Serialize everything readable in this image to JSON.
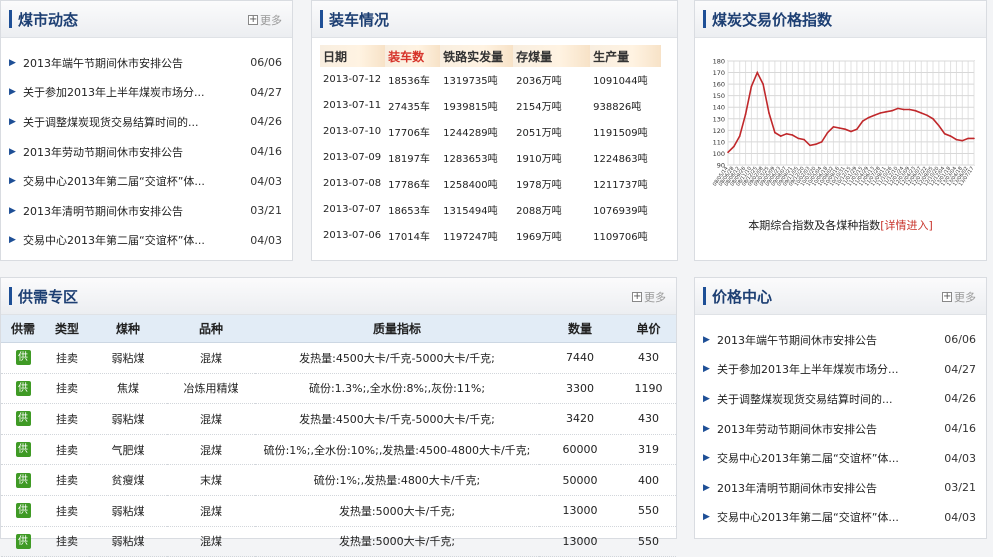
{
  "market_news": {
    "title": "煤市动态",
    "more": "更多",
    "items": [
      {
        "title": "2013年端午节期间休市安排公告",
        "date": "06/06"
      },
      {
        "title": "关于参加2013年上半年煤炭市场分...",
        "date": "04/27"
      },
      {
        "title": "关于调整煤炭现货交易结算时间的...",
        "date": "04/26"
      },
      {
        "title": "2013年劳动节期间休市安排公告",
        "date": "04/16"
      },
      {
        "title": "交易中心2013年第二届“交谊杯”体...",
        "date": "04/03"
      },
      {
        "title": "2013年清明节期间休市安排公告",
        "date": "03/21"
      },
      {
        "title": "交易中心2013年第二届“交谊杯”体...",
        "date": "04/03"
      }
    ]
  },
  "loading": {
    "title": "装车情况",
    "headers": [
      "日期",
      "装车数",
      "铁路实发量",
      "存煤量",
      "生产量"
    ],
    "rows": [
      [
        "2013-07-12",
        "18536车",
        "1319735吨",
        "2036万吨",
        "1091044吨"
      ],
      [
        "2013-07-11",
        "27435车",
        "1939815吨",
        "2154万吨",
        "938826吨"
      ],
      [
        "2013-07-10",
        "17706车",
        "1244289吨",
        "2051万吨",
        "1191509吨"
      ],
      [
        "2013-07-09",
        "18197车",
        "1283653吨",
        "1910万吨",
        "1224863吨"
      ],
      [
        "2013-07-08",
        "17786车",
        "1258400吨",
        "1978万吨",
        "1211737吨"
      ],
      [
        "2013-07-07",
        "18653车",
        "1315494吨",
        "2088万吨",
        "1076939吨"
      ],
      [
        "2013-07-06",
        "17014车",
        "1197247吨",
        "1969万吨",
        "1109706吨"
      ]
    ]
  },
  "price_index": {
    "title": "煤炭交易价格指数",
    "caption": "本期综合指数及各煤种指数",
    "caption_link": "[详情进入]"
  },
  "chart_data": {
    "type": "line",
    "title": "",
    "xlabel": "",
    "ylabel": "",
    "ylim": [
      90,
      180
    ],
    "yticks": [
      90,
      100,
      110,
      120,
      130,
      140,
      150,
      160,
      170,
      180
    ],
    "grid": true,
    "color": "#c0282b",
    "x": [
      "08/05/14",
      "08/06/28",
      "08/08/12",
      "08/09/26",
      "08/11/10",
      "08/12/25",
      "09/02/08",
      "09/03/25",
      "09/05/09",
      "09/06/23",
      "09/08/07",
      "09/09/21",
      "09/11/05",
      "09/12/20",
      "10/02/03",
      "10/03/20",
      "10/05/04",
      "10/06/18",
      "10/08/02",
      "10/09/16",
      "10/10/31",
      "10/12/15",
      "11/01/29",
      "11/03/15",
      "11/04/29",
      "11/06/13",
      "11/07/28",
      "11/09/11",
      "11/10/26",
      "11/12/10",
      "12/01/24",
      "12/03/09",
      "12/04/23",
      "12/06/07",
      "12/07/22",
      "12/09/05",
      "12/10/20",
      "12/12/04",
      "13/01/18",
      "13/03/04",
      "13/04/18",
      "13/06/02",
      "13/07/17"
    ],
    "values": [
      101,
      106,
      115,
      134,
      158,
      170,
      160,
      135,
      118,
      115,
      117,
      116,
      113,
      112,
      107,
      108,
      110,
      118,
      123,
      122,
      121,
      119,
      121,
      128,
      131,
      133,
      135,
      136,
      137,
      139,
      138,
      138,
      137,
      135,
      133,
      130,
      124,
      117,
      115,
      112,
      111,
      113,
      113
    ]
  },
  "supply": {
    "title": "供需专区",
    "more": "更多",
    "headers": [
      "供需",
      "类型",
      "煤种",
      "品种",
      "质量指标",
      "数量",
      "单价"
    ],
    "rows": [
      {
        "badge": "供",
        "type": "挂卖",
        "coal": "弱粘煤",
        "variety": "混煤",
        "quality": "发热量:4500大卡/千克-5000大卡/千克;",
        "qty": "7440",
        "price": "430"
      },
      {
        "badge": "供",
        "type": "挂卖",
        "coal": "焦煤",
        "variety": "冶炼用精煤",
        "quality": "硫份:1.3%;,全水份:8%;,灰份:11%;",
        "qty": "3300",
        "price": "1190"
      },
      {
        "badge": "供",
        "type": "挂卖",
        "coal": "弱粘煤",
        "variety": "混煤",
        "quality": "发热量:4500大卡/千克-5000大卡/千克;",
        "qty": "3420",
        "price": "430"
      },
      {
        "badge": "供",
        "type": "挂卖",
        "coal": "气肥煤",
        "variety": "混煤",
        "quality": "硫份:1%;,全水份:10%;,发热量:4500-4800大卡/千克;",
        "qty": "60000",
        "price": "319"
      },
      {
        "badge": "供",
        "type": "挂卖",
        "coal": "贫瘦煤",
        "variety": "末煤",
        "quality": "硫份:1%;,发热量:4800大卡/千克;",
        "qty": "50000",
        "price": "400"
      },
      {
        "badge": "供",
        "type": "挂卖",
        "coal": "弱粘煤",
        "variety": "混煤",
        "quality": "发热量:5000大卡/千克;",
        "qty": "13000",
        "price": "550"
      },
      {
        "badge": "供",
        "type": "挂卖",
        "coal": "弱粘煤",
        "variety": "混煤",
        "quality": "发热量:5000大卡/千克;",
        "qty": "13000",
        "price": "550"
      }
    ]
  },
  "price_center": {
    "title": "价格中心",
    "more": "更多",
    "items": [
      {
        "title": "2013年端午节期间休市安排公告",
        "date": "06/06"
      },
      {
        "title": "关于参加2013年上半年煤炭市场分...",
        "date": "04/27"
      },
      {
        "title": "关于调整煤炭现货交易结算时间的...",
        "date": "04/26"
      },
      {
        "title": "2013年劳动节期间休市安排公告",
        "date": "04/16"
      },
      {
        "title": "交易中心2013年第二届“交谊杯”体...",
        "date": "04/03"
      },
      {
        "title": "2013年清明节期间休市安排公告",
        "date": "03/21"
      },
      {
        "title": "交易中心2013年第二届“交谊杯”体...",
        "date": "04/03"
      }
    ]
  }
}
